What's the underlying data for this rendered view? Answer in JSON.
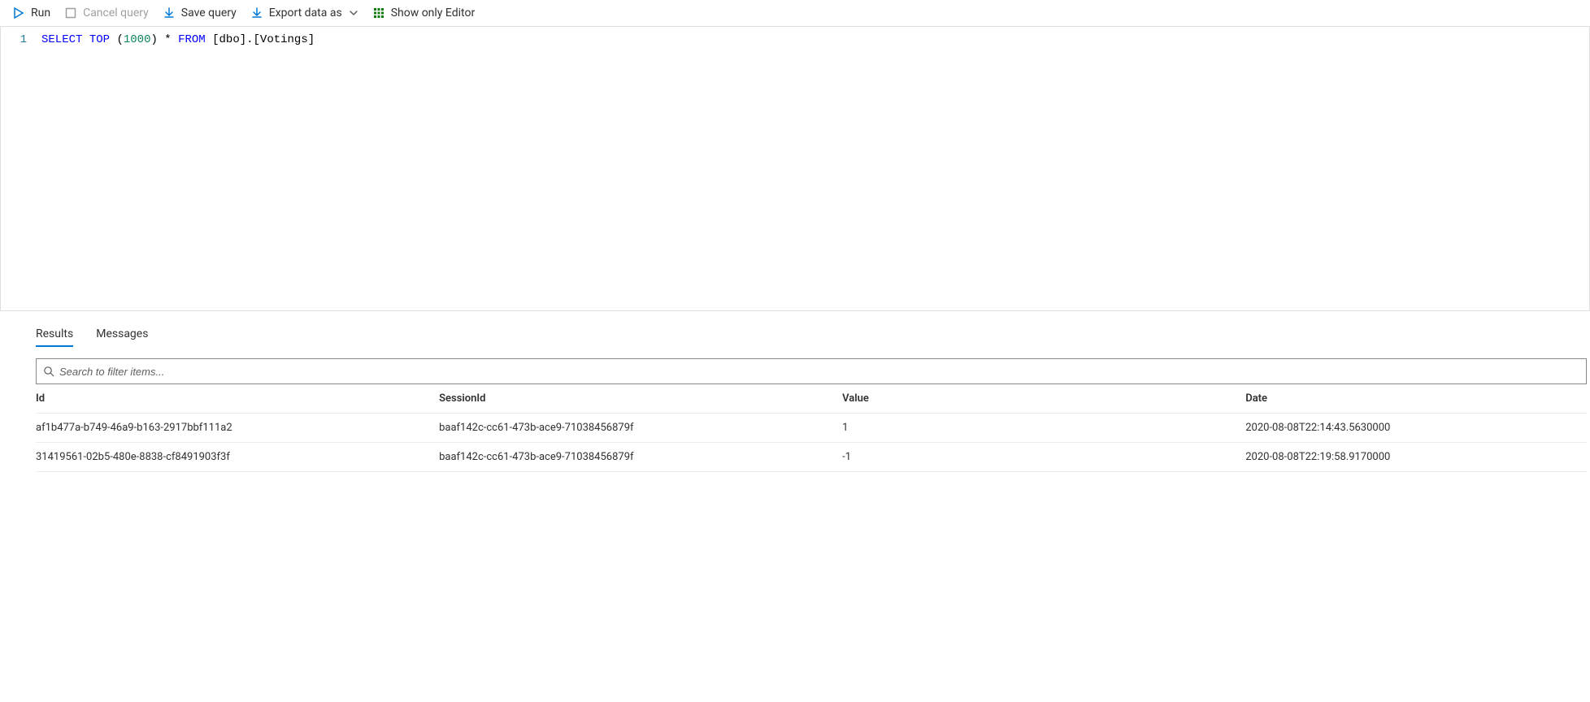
{
  "toolbar": {
    "run": "Run",
    "cancel": "Cancel query",
    "save": "Save query",
    "export": "Export data as",
    "show_editor": "Show only Editor"
  },
  "editor": {
    "line_number": "1",
    "tokens": {
      "select": "SELECT",
      "top": "TOP",
      "lparen": "(",
      "count": "1000",
      "rparen": ")",
      "star": "*",
      "from": "FROM",
      "table": "[dbo].[Votings]"
    }
  },
  "tabs": {
    "results": "Results",
    "messages": "Messages"
  },
  "filter": {
    "placeholder": "Search to filter items..."
  },
  "columns": {
    "id": "Id",
    "session": "SessionId",
    "value": "Value",
    "date": "Date"
  },
  "rows": [
    {
      "id": "af1b477a-b749-46a9-b163-2917bbf111a2",
      "session": "baaf142c-cc61-473b-ace9-71038456879f",
      "value": "1",
      "date": "2020-08-08T22:14:43.5630000"
    },
    {
      "id": "31419561-02b5-480e-8838-cf8491903f3f",
      "session": "baaf142c-cc61-473b-ace9-71038456879f",
      "value": "-1",
      "date": "2020-08-08T22:19:58.9170000"
    }
  ]
}
